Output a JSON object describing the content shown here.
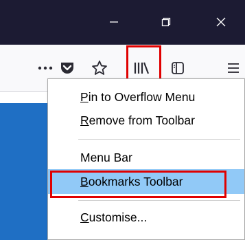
{
  "titlebar": {
    "buttons": {
      "minimize_icon": "minimize-icon",
      "restore_icon": "restore-icon",
      "close_icon": "close-icon"
    },
    "background": "#1c1b33"
  },
  "toolbar": {
    "more_label": "•••",
    "icons": [
      "more-icon",
      "pocket-icon",
      "star-icon",
      "library-icon",
      "sidebar-icon",
      "hamburger-menu-icon"
    ]
  },
  "context_menu": {
    "items": [
      {
        "accel": "P",
        "rest": "in to Overflow Menu"
      },
      {
        "accel": "R",
        "rest": "emove from Toolbar"
      },
      {
        "pre": "Menu Bar"
      },
      {
        "accel": "B",
        "rest": "ookmarks Toolbar"
      },
      {
        "accel": "C",
        "rest": "ustomise..."
      }
    ],
    "highlight_color": "#91c9f7"
  },
  "annotation_color": "#e00000",
  "page_accent": "#1f6fc4"
}
